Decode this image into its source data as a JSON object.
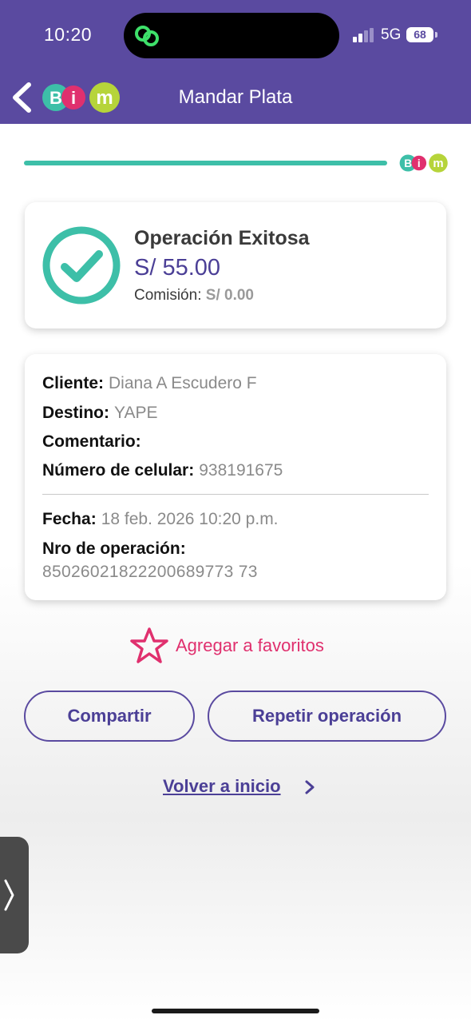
{
  "status_bar": {
    "time": "10:20",
    "network": "5G",
    "battery": "68"
  },
  "header": {
    "title": "Mandar Plata",
    "logo_letters": [
      "B",
      "i",
      "m"
    ],
    "background_color": "#5a4aa0"
  },
  "progress": {
    "fraction": 1.0,
    "color": "#3dbfa8"
  },
  "success_card": {
    "title": "Operación Exitosa",
    "amount": "S/ 55.00",
    "fee_label": "Comisión:",
    "fee_value": "S/ 0.00",
    "icon": "check-circle-icon"
  },
  "details": {
    "cliente_label": "Cliente:",
    "cliente_value": "Diana A Escudero F",
    "destino_label": "Destino:",
    "destino_value": "YAPE",
    "comentario_label": "Comentario:",
    "comentario_value": "",
    "celular_label": "Número de celular:",
    "celular_value": "938191675",
    "fecha_label": "Fecha:",
    "fecha_value": "18 feb. 2026 10:20 p.m.",
    "operacion_label": "Nro de operación:",
    "operacion_value": "85026021822200689773 73"
  },
  "actions": {
    "favorite_label": "Agregar a favoritos",
    "share_label": "Compartir",
    "repeat_label": "Repetir operación",
    "home_label": "Volver a inicio"
  },
  "colors": {
    "brand_purple": "#5a4aa0",
    "accent_teal": "#3dbfa8",
    "favorite_pink": "#e0306e"
  }
}
